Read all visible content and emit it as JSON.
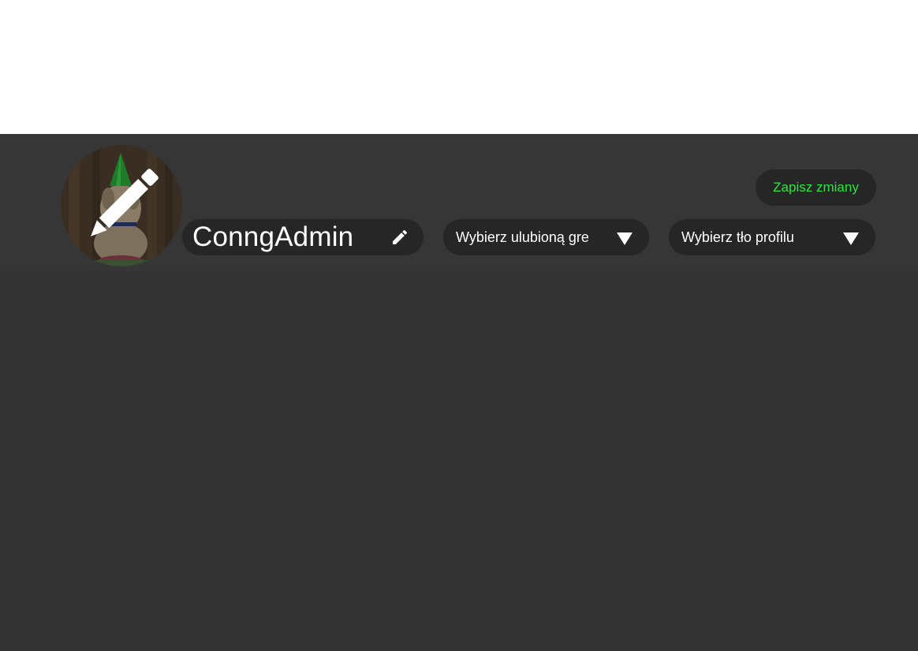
{
  "profile": {
    "username": "ConngAdmin",
    "avatar_icon": "party-hat-dog-avatar",
    "avatar_edit_icon": "pencil-icon",
    "username_edit_icon": "pencil-icon"
  },
  "selects": {
    "favorite_game": {
      "label": "Wybierz ulubioną gre",
      "arrow_icon": "triangle-down-icon"
    },
    "profile_background": {
      "label": "Wybierz tło profilu",
      "arrow_icon": "triangle-down-icon"
    }
  },
  "actions": {
    "save_label": "Zapisz zmiany"
  },
  "colors": {
    "panel_background": "#333333",
    "pill_background": "#262626",
    "save_text": "#27e83f",
    "text_primary": "#ffffff"
  }
}
